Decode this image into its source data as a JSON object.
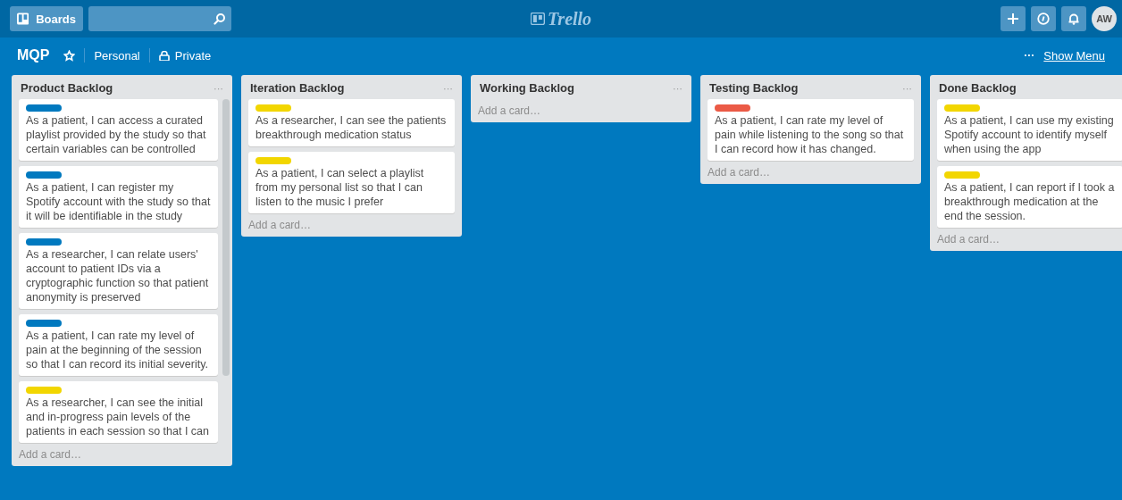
{
  "header": {
    "boards_button": "Boards",
    "logo": "Trello",
    "avatar": "AW"
  },
  "board": {
    "title": "MQP",
    "starred": false,
    "team": "Personal",
    "visibility": "Private",
    "menu_link": "Show Menu",
    "menu_dots": "···"
  },
  "lists": [
    {
      "title": "Product Backlog",
      "menu": "···",
      "add_card": "Add a card…",
      "cards": [
        {
          "color": "#0079bf",
          "text": "As a patient, I can access a curated playlist provided by the study so that certain variables can be controlled"
        },
        {
          "color": "#0079bf",
          "text": "As a patient, I can register my Spotify account with the study so that it will be identifiable in the study"
        },
        {
          "color": "#0079bf",
          "text": "As a researcher, I can relate users' account to patient IDs via a cryptographic function so that patient anonymity is preserved"
        },
        {
          "color": "#0079bf",
          "text": "As a patient, I can rate my level of pain at the beginning of the session so that I can record its initial severity."
        },
        {
          "color": "#f2d600",
          "text": "As a researcher, I can see the initial and in-progress pain levels of the patients in each session so that I can"
        }
      ]
    },
    {
      "title": "Iteration Backlog",
      "menu": "···",
      "add_card": "Add a card…",
      "cards": [
        {
          "color": "#f2d600",
          "text": "As a researcher, I can see the patients breakthrough medication status"
        },
        {
          "color": "#f2d600",
          "text": "As a patient, I can select a playlist from my personal list so that I can listen to the music I prefer"
        }
      ]
    },
    {
      "title": "Working Backlog",
      "menu": "···",
      "add_card": "Add a card…"
    },
    {
      "title": "Testing Backlog",
      "menu": "···",
      "add_card": "Add a card…",
      "cards": [
        {
          "color": "#eb5a46",
          "text": "As a patient, I can rate my level of pain while listening to the song so that I can record how it has changed."
        }
      ]
    },
    {
      "title": "Done Backlog",
      "add_card": "Add a card…",
      "cards": [
        {
          "color": "#f2d600",
          "text": "As a patient, I can use my existing Spotify account to identify myself when using the app"
        },
        {
          "color": "#f2d600",
          "text": "As a patient, I can report if I took a breakthrough medication at the end the session."
        }
      ]
    }
  ]
}
